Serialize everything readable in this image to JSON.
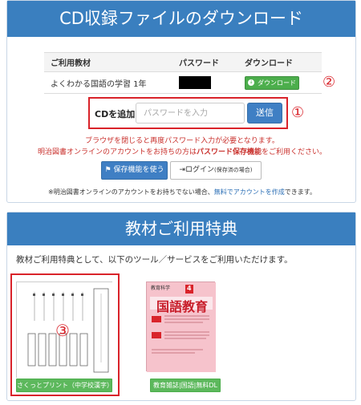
{
  "cd_section": {
    "title": "CD収録ファイルのダウンロード",
    "table": {
      "headers": [
        "ご利用教材",
        "パスワード",
        "ダウンロード"
      ],
      "rows": [
        {
          "material": "よくわかる国語の学習 1年",
          "download_label": "ダウンロード"
        }
      ]
    },
    "add_label": "CDを追加:",
    "password_placeholder": "パスワードを入力",
    "send_label": "送信",
    "warning_line1": "ブラウザを閉じると再度パスワード入力が必要となります。",
    "warning_line2_prefix": "明治図書オンラインのアカウントをお持ちの方は",
    "warning_line2_bold": "パスワード保存機能",
    "warning_line2_suffix": "をご利用ください。",
    "save_button_label": "保存機能を使う",
    "login_button_label": "ログイン",
    "login_button_note": "(保存済の場合)",
    "note_prefix": "※明治図書オンラインのアカウントをお持ちでない場合、",
    "note_link": "無料でアカウントを作成",
    "note_suffix": "できます。"
  },
  "benefits_section": {
    "title": "教材ご利用特典",
    "intro": "教材ご利用特典として、以下のツール／サービスをご利用いただけます。",
    "tools": [
      {
        "label": "さくっとプリント（中学校漢字）"
      },
      {
        "label": "教育雑誌|国語|無料DL",
        "magazine_title": "国語教育",
        "magazine_top": "教育科学",
        "magazine_month": "4"
      }
    ]
  },
  "annotations": {
    "a1": "①",
    "a2": "②",
    "a3": "③"
  },
  "colors": {
    "header_blue": "#3a7fbf",
    "accent_red": "#d9232a",
    "green": "#4cae4c",
    "button_blue": "#3f7fc4"
  }
}
